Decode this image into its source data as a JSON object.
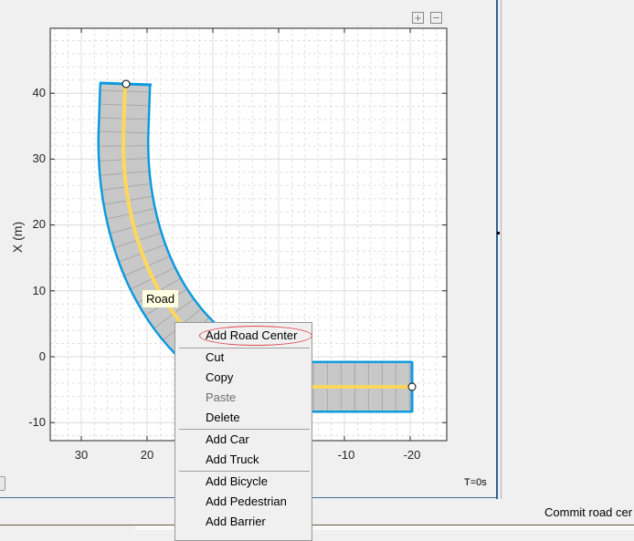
{
  "toolbar": {
    "zoom_in": "+",
    "zoom_out": "−"
  },
  "plot": {
    "ylabel": "X (m)",
    "x_ticks": [
      "30",
      "20",
      "-10",
      "-20"
    ],
    "y_ticks": [
      "40",
      "30",
      "20",
      "10",
      "0",
      "-10"
    ],
    "time_label": "T=0s",
    "road_tooltip": "Road",
    "colors": {
      "road_edge": "#0d9ae0",
      "road_surface": "#c8c8c8",
      "center_line": "#ffd75a"
    }
  },
  "context_menu": {
    "items": [
      {
        "label": "Add Road Center",
        "enabled": true
      },
      {
        "label": "Cut",
        "enabled": true
      },
      {
        "label": "Copy",
        "enabled": true
      },
      {
        "label": "Paste",
        "enabled": false
      },
      {
        "label": "Delete",
        "enabled": true
      },
      {
        "label": "Add Car",
        "enabled": true
      },
      {
        "label": "Add Truck",
        "enabled": true
      },
      {
        "label": "Add Bicycle",
        "enabled": true
      },
      {
        "label": "Add Pedestrian",
        "enabled": true
      },
      {
        "label": "Add Barrier",
        "enabled": true
      }
    ]
  },
  "status_bar": {
    "text": "Commit road cer"
  }
}
